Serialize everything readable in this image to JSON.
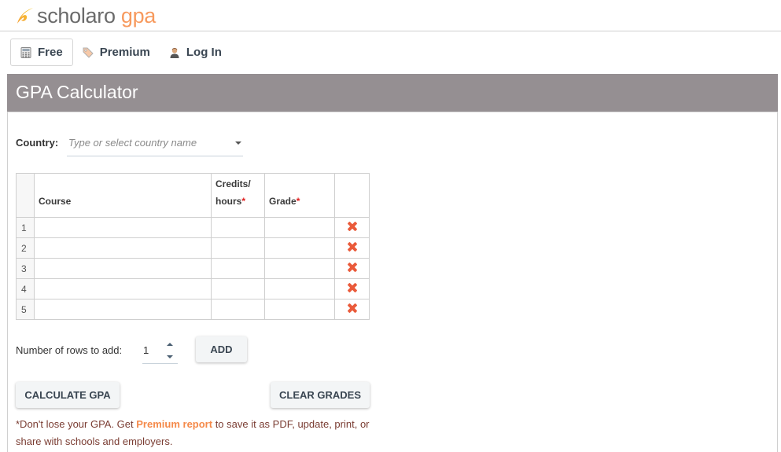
{
  "brand": {
    "name_part1": "scholaro",
    "name_part2": "gpa",
    "logo_icon": "swirl-logo-icon",
    "colors": {
      "gray": "#6b6b6b",
      "orange": "#f79a5e"
    }
  },
  "nav": {
    "items": [
      {
        "label": "Free",
        "icon": "calculator-icon",
        "active": true
      },
      {
        "label": "Premium",
        "icon": "tag-icon",
        "active": false
      },
      {
        "label": "Log In",
        "icon": "user-icon",
        "active": false
      }
    ]
  },
  "panel": {
    "title": "GPA Calculator",
    "header_color": "#958f92"
  },
  "country": {
    "label": "Country:",
    "placeholder": "Type or select country name",
    "value": ""
  },
  "table": {
    "headers": {
      "number": "",
      "course": "Course",
      "credits_line1": "Credits/",
      "credits_line2": "hours",
      "grade": "Grade",
      "required_mark": "*",
      "delete": ""
    },
    "rows": [
      {
        "num": "1",
        "course": "",
        "credits": "",
        "grade": ""
      },
      {
        "num": "2",
        "course": "",
        "credits": "",
        "grade": ""
      },
      {
        "num": "3",
        "course": "",
        "credits": "",
        "grade": ""
      },
      {
        "num": "4",
        "course": "",
        "credits": "",
        "grade": ""
      },
      {
        "num": "5",
        "course": "",
        "credits": "",
        "grade": ""
      }
    ],
    "delete_icon": "red-x-delete-icon"
  },
  "add_rows": {
    "label": "Number of rows to add:",
    "value": "1",
    "button": "ADD"
  },
  "actions": {
    "calculate": "CALCULATE GPA",
    "clear": "CLEAR GRADES"
  },
  "note": {
    "prefix": "*Don't lose your GPA. Get ",
    "link": "Premium report",
    "suffix": " to save it as PDF, update, print, or share with schools and employers."
  }
}
